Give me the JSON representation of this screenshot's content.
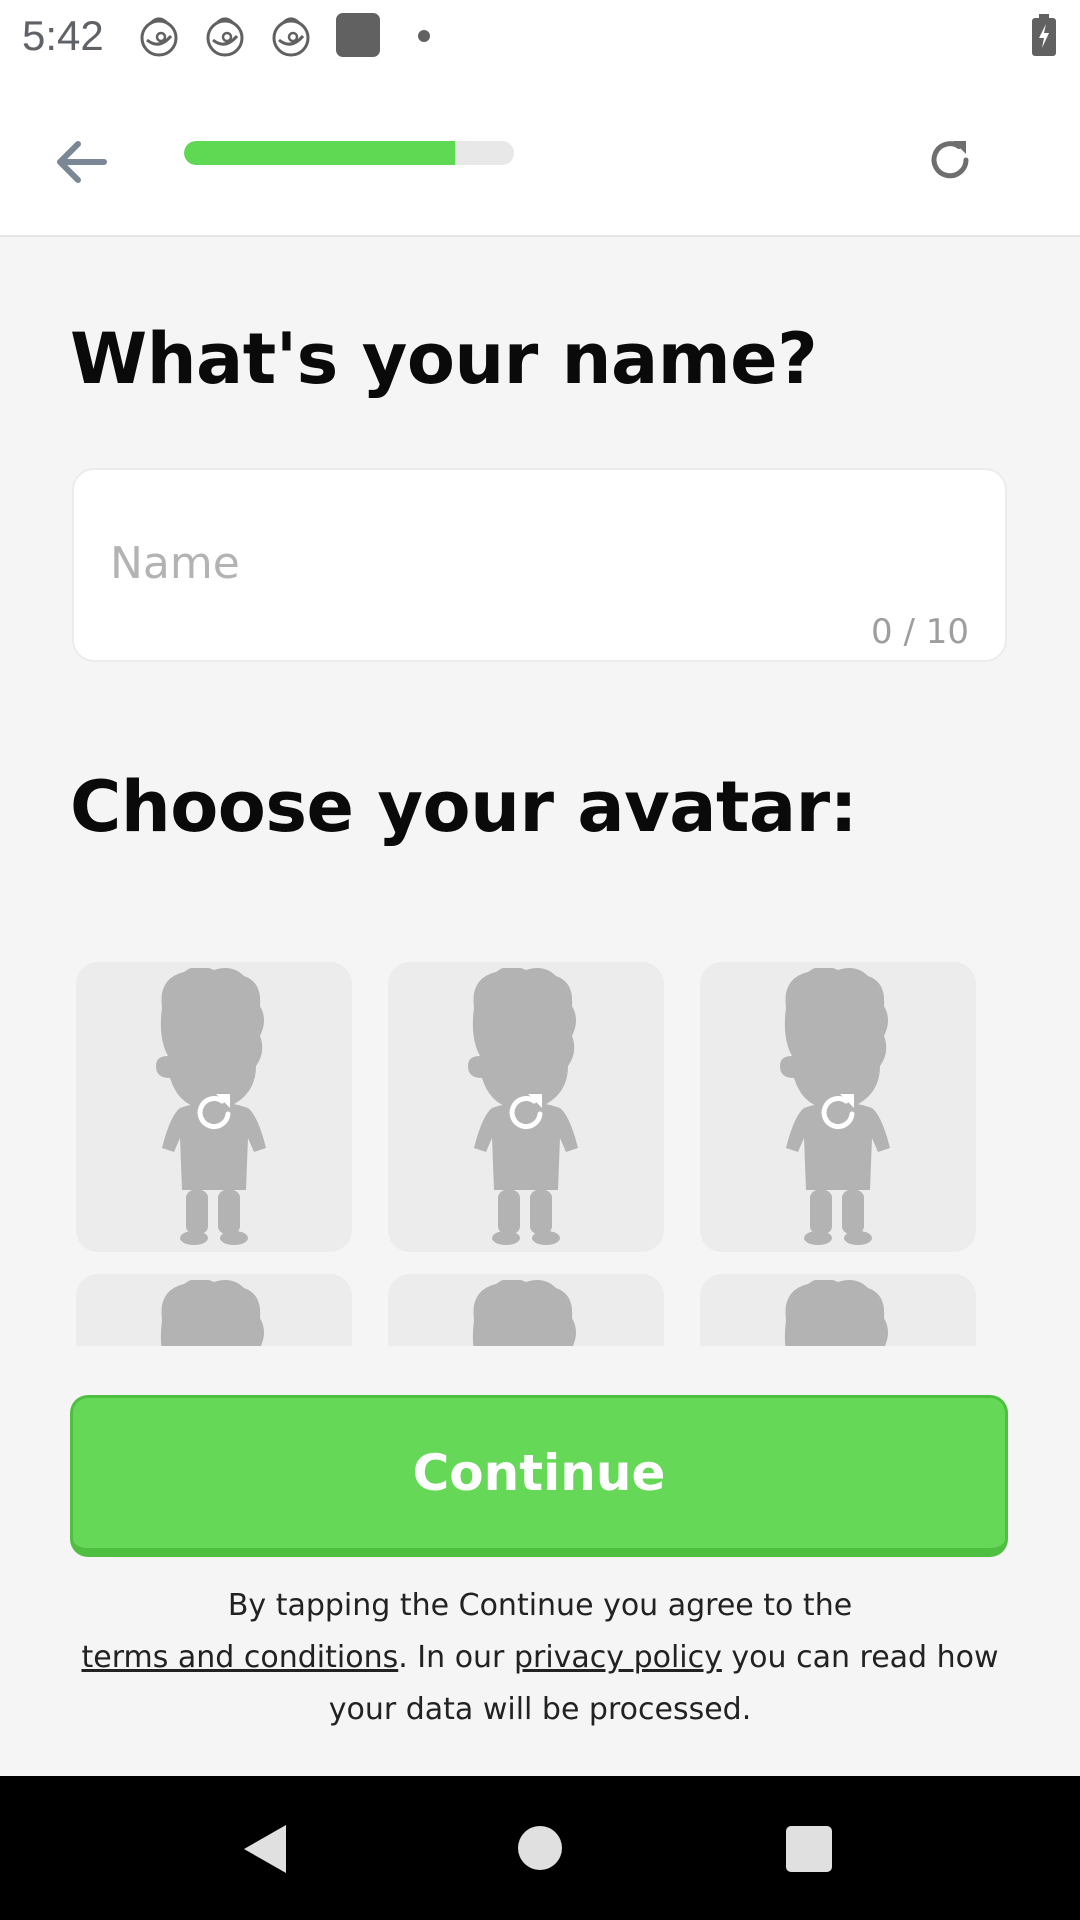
{
  "status_bar": {
    "time": "5:42",
    "notification_icons": [
      "baby-face-icon",
      "baby-face-icon",
      "baby-face-icon",
      "app-square-icon",
      "dot-icon"
    ],
    "battery_icon": "battery-charging-icon"
  },
  "toolbar": {
    "back_icon": "arrow-left-icon",
    "progress_fraction": 0.82,
    "refresh_icon": "refresh-icon",
    "accent_color": "#5fd853"
  },
  "name_section": {
    "title": "What's your name?",
    "input_placeholder": "Name",
    "input_value": "",
    "counter": "0 / 10"
  },
  "avatar_section": {
    "title": "Choose your avatar:",
    "avatars": [
      {
        "icon": "avatar-placeholder-icon",
        "overlay_icon": "refresh-icon"
      },
      {
        "icon": "avatar-placeholder-icon",
        "overlay_icon": "refresh-icon"
      },
      {
        "icon": "avatar-placeholder-icon",
        "overlay_icon": "refresh-icon"
      },
      {
        "icon": "avatar-placeholder-icon"
      },
      {
        "icon": "avatar-placeholder-icon"
      },
      {
        "icon": "avatar-placeholder-icon"
      }
    ]
  },
  "continue_button": {
    "label": "Continue",
    "color": "#65d957"
  },
  "legal": {
    "line1": "By tapping the Continue you agree to the",
    "terms_link": "terms and conditions",
    "middle": ". In our ",
    "privacy_link": "privacy policy",
    "end": " you can read how your data will be processed."
  },
  "nav_bar": {
    "back_icon": "triangle-back-icon",
    "home_icon": "circle-home-icon",
    "recents_icon": "square-recents-icon"
  }
}
